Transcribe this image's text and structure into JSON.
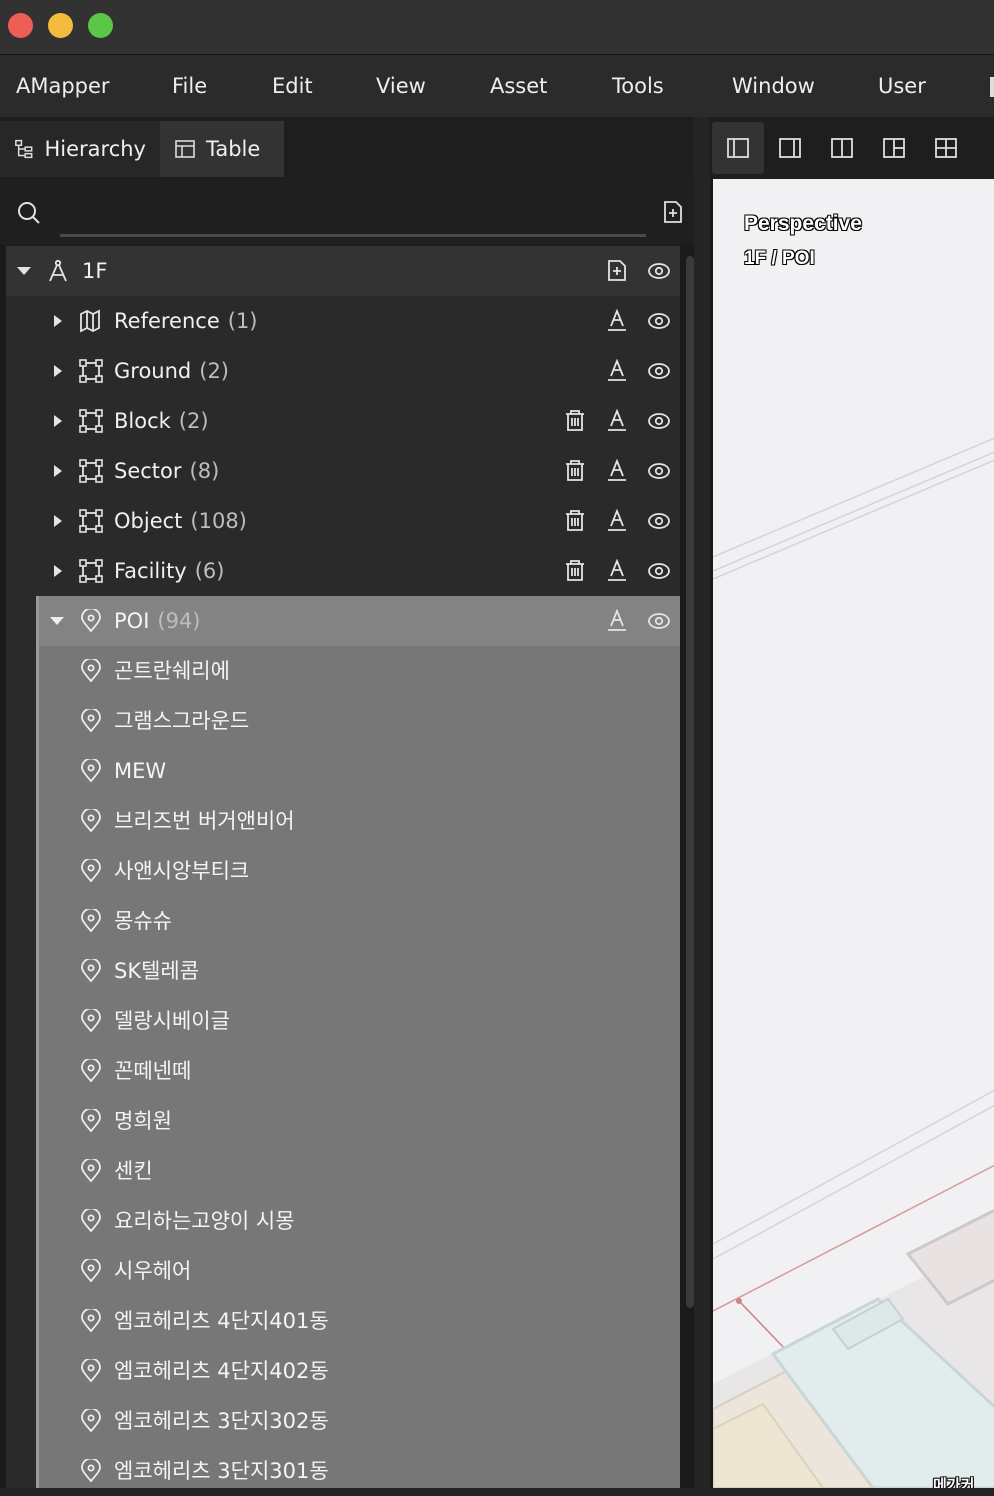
{
  "window": {
    "traffic_lights": {
      "close_color": "#ee5e57",
      "minimize_color": "#f4bc3f",
      "zoom_color": "#5cc647"
    }
  },
  "menu": {
    "app_name": "AMapper",
    "items": [
      "File",
      "Edit",
      "View",
      "Asset",
      "Tools",
      "Window",
      "User"
    ]
  },
  "panel_tabs": {
    "hierarchy": "Hierarchy",
    "table": "Table",
    "active": "Hierarchy"
  },
  "search": {
    "value": "",
    "placeholder": ""
  },
  "tree": {
    "root": {
      "label": "1F",
      "expanded": true
    },
    "layers": [
      {
        "label": "Reference",
        "count": "(1)",
        "icon": "map-icon",
        "has_delete": false,
        "expanded": false
      },
      {
        "label": "Ground",
        "count": "(2)",
        "icon": "polygon-icon",
        "has_delete": false,
        "expanded": false
      },
      {
        "label": "Block",
        "count": "(2)",
        "icon": "polygon-icon",
        "has_delete": true,
        "expanded": false
      },
      {
        "label": "Sector",
        "count": "(8)",
        "icon": "polygon-icon",
        "has_delete": true,
        "expanded": false
      },
      {
        "label": "Object",
        "count": "(108)",
        "icon": "polygon-icon",
        "has_delete": true,
        "expanded": false
      },
      {
        "label": "Facility",
        "count": "(6)",
        "icon": "polygon-icon",
        "has_delete": true,
        "expanded": false
      }
    ],
    "poi": {
      "label": "POI",
      "count": "(94)",
      "expanded": true,
      "selected": true,
      "items": [
        "곤트란쉐리에",
        "그램스그라운드",
        "MEW",
        "브리즈번 버거앤비어",
        "사앤시앙부티크",
        "몽슈슈",
        "SK텔레콤",
        "델랑시베이글",
        "꼰떼넨떼",
        "명희원",
        "센킨",
        "요리하는고양이 시몽",
        "시우헤어",
        "엠코헤리츠 4단지401동",
        "엠코헤리츠 4단지402동",
        "엠코헤리츠 3단지302동",
        "엠코헤리츠 3단지301동"
      ]
    }
  },
  "viewport": {
    "mode": "Perspective",
    "path": "1F / POI",
    "bottom_label": "메가커",
    "background": "#f1f0f2"
  },
  "view_layout_buttons": [
    "left-panel-layout",
    "right-panel-layout",
    "two-column-layout",
    "three-pane-layout",
    "four-grid-layout"
  ]
}
